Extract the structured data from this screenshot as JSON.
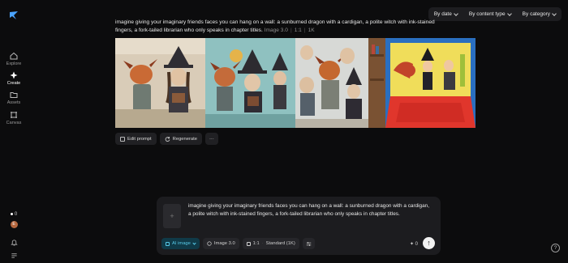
{
  "sidebar": {
    "items": [
      {
        "label": "Explore",
        "icon": "home-icon"
      },
      {
        "label": "Create",
        "icon": "sparkle-icon"
      },
      {
        "label": "Assets",
        "icon": "folder-icon"
      },
      {
        "label": "Canvas",
        "icon": "canvas-icon"
      }
    ],
    "credits": "0",
    "avatar_initial": "E"
  },
  "filters": {
    "date": "By date",
    "content_type": "By content type",
    "category": "By category"
  },
  "generation": {
    "prompt": "imagine giving your imaginary friends faces you can hang on a wall: a sunburned dragon with a cardigan, a polite witch with ink-stained fingers, a fork-tailed librarian who only speaks in chapter titles.",
    "model": "Image 3.0",
    "ratio": "1:1",
    "resolution": "1K"
  },
  "actions": {
    "edit_prompt": "Edit prompt",
    "regenerate": "Regenerate",
    "more": "···"
  },
  "composer": {
    "upload_symbol": "+",
    "text": "imagine giving your imaginary friends faces you can hang on a wall: a sunburned dragon with a cardigan, a polite witch with ink-stained fingers, a fork-tailed librarian who only speaks in chapter titles.",
    "mode": "AI image",
    "model": "Image 3.0",
    "ratio": "1:1",
    "quality": "Standard (1K)",
    "count_value": "0",
    "send_symbol": "↑"
  },
  "help_symbol": "?",
  "colors": {
    "background": "#0c0c0d",
    "panel": "#1c1c1f",
    "accent": "#57c8e6"
  }
}
